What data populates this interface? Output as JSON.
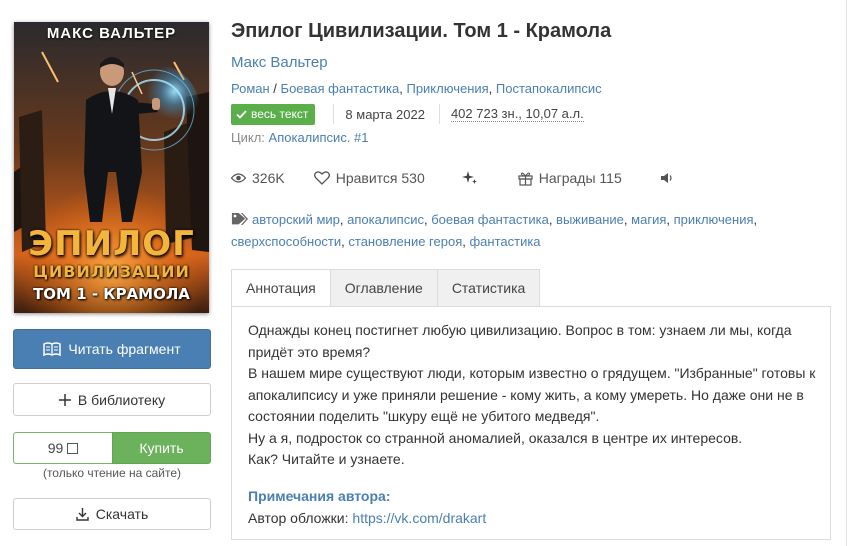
{
  "cover": {
    "author": "МАКС ВАЛЬТЕР",
    "title_line1": "ЭПИЛОГ",
    "title_line2": "ЦИВИЛИЗАЦИИ",
    "title_line3": "ТОМ 1 - КРАМОЛА"
  },
  "actions": {
    "read_fragment": "Читать фрагмент",
    "add_library": "В библиотеку",
    "price": "99",
    "buy": "Купить",
    "buy_note": "(только чтение на сайте)",
    "download": "Скачать"
  },
  "book": {
    "title": "Эпилог Цивилизации. Том 1 - Крамола",
    "author": "Макс Вальтер",
    "genres": [
      "Роман",
      "Боевая фантастика",
      "Приключения",
      "Постапокалипсис"
    ],
    "genre_sep1": " / ",
    "genre_sep": ", ",
    "status_badge": "весь текст",
    "date": "8 марта 2022",
    "size": "402 723 зн., 10,07 а.л.",
    "cycle_label": "Цикл: ",
    "cycle_name": "Апокалипсис. #1"
  },
  "stats": {
    "views": "326K",
    "likes": "Нравится 530",
    "awards": "Награды 115"
  },
  "tags": [
    "авторский мир",
    "апокалипсис",
    "боевая фантастика",
    "выживание",
    "магия",
    "приключения",
    "сверхспособности",
    "становление героя",
    "фантастика"
  ],
  "tabs": [
    "Аннотация",
    "Оглавление",
    "Статистика"
  ],
  "annotation": [
    "Однажды конец постигнет любую цивилизацию. Вопрос в том: узнаем ли мы, когда придёт это время?",
    "В нашем мире существуют люди, которым известно о грядущем. \"Избранные\" готовы к апокалипсису и уже приняли решение - кому жить, а кому умереть. Но даже они не в состоянии поделить \"шкуру ещё не убитого медведя\".",
    "Ну а я, подросток со странной аномалией, оказался в центре их интересов.",
    "Как? Читайте и узнаете."
  ],
  "author_notes": {
    "heading": "Примечания автора:",
    "label": "Автор обложки: ",
    "link": "https://vk.com/drakart"
  },
  "colors": {
    "accent": "#4a7fb3",
    "buy_green": "#6cb15b",
    "badge_green": "#5aaf4b"
  }
}
